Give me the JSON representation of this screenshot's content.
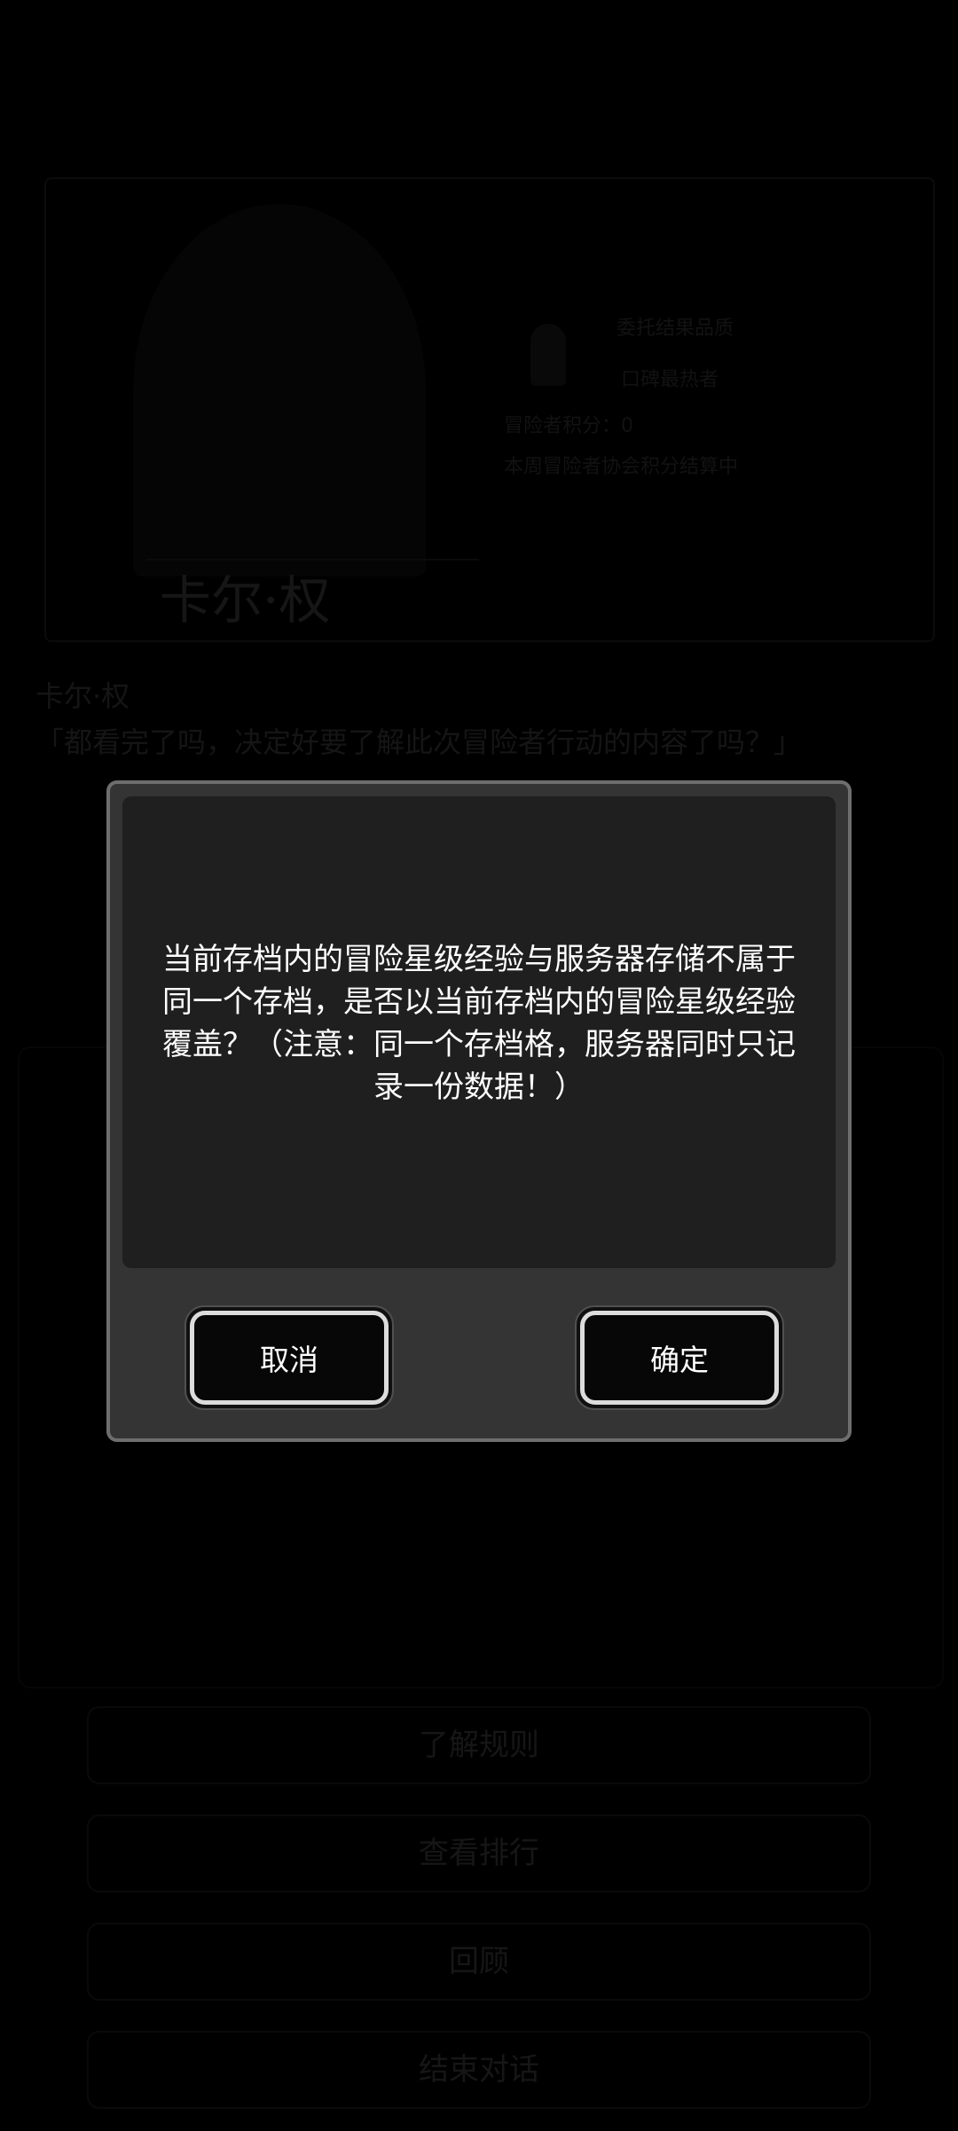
{
  "background": {
    "portrait_name": "卡尔·权",
    "info_lines": [
      "委托结果品质",
      "口碑最热者",
      "冒险者积分：0",
      "本周冒险者协会积分结算中"
    ],
    "speaker": "卡尔·权",
    "speech": "「都看完了吗，决定好要了解此次冒险者行动的内容了吗？」",
    "options": [
      "了解规则",
      "查看排行",
      "回顾",
      "结束对话"
    ]
  },
  "dialog": {
    "message": "当前存档内的冒险星级经验与服务器存储不属于同一个存档，是否以当前存档内的冒险星级经验覆盖？（注意：同一个存档格，服务器同时只记录一份数据！）",
    "cancel_label": "取消",
    "confirm_label": "确定"
  },
  "colors": {
    "modal_bg": "#343434",
    "modal_inner_bg": "#1f1f1f",
    "modal_border": "#6e6e6e",
    "button_bg": "#070707",
    "button_border": "#dcdcdc"
  }
}
